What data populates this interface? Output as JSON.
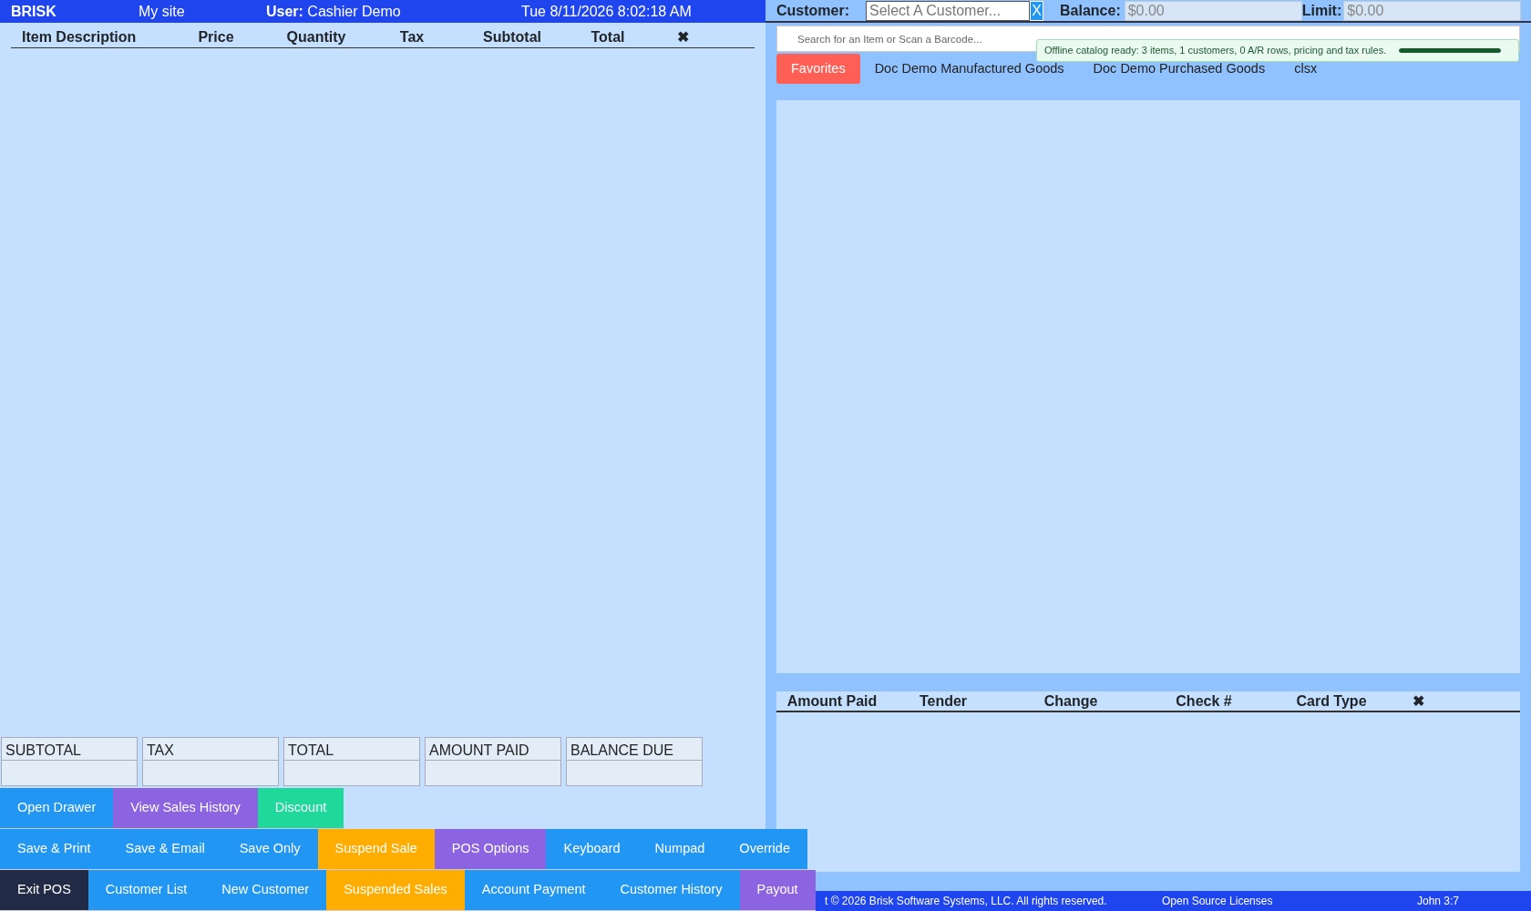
{
  "top_bar": {
    "brand": "BRISK",
    "site": "My site",
    "user_label": "User:",
    "user": "Cashier Demo",
    "datetime": "Tue 8/11/2026 8:02:18 AM"
  },
  "item_table": {
    "columns": [
      "Item Description",
      "Price",
      "Quantity",
      "Tax",
      "Subtotal",
      "Total",
      "✖"
    ]
  },
  "totals": [
    {
      "label": "SUBTOTAL"
    },
    {
      "label": "TAX"
    },
    {
      "label": "TOTAL"
    },
    {
      "label": "AMOUNT PAID"
    },
    {
      "label": "BALANCE DUE"
    }
  ],
  "button_rows": [
    [
      {
        "label": "Open Drawer",
        "color": "#2196f3"
      },
      {
        "label": "View Sales History",
        "color": "#8c63e0"
      },
      {
        "label": "Discount",
        "color": "#1ed99a"
      }
    ],
    [
      {
        "label": "Save & Print",
        "color": "#2196f3"
      },
      {
        "label": "Save & Email",
        "color": "#2196f3"
      },
      {
        "label": "Save Only",
        "color": "#2196f3"
      },
      {
        "label": "Suspend Sale",
        "color": "#ffad00"
      },
      {
        "label": "POS Options",
        "color": "#8c63e0"
      },
      {
        "label": "Keyboard",
        "color": "#2196f3"
      },
      {
        "label": "Numpad",
        "color": "#2196f3"
      },
      {
        "label": "Override",
        "color": "#2196f3"
      }
    ],
    [
      {
        "label": "Exit POS",
        "color": "#222b45"
      },
      {
        "label": "Customer List",
        "color": "#2196f3"
      },
      {
        "label": "New Customer",
        "color": "#2196f3"
      },
      {
        "label": "Suspended Sales",
        "color": "#ffad00"
      },
      {
        "label": "Account Payment",
        "color": "#2196f3"
      },
      {
        "label": "Customer History",
        "color": "#2196f3"
      },
      {
        "label": "Payout",
        "color": "#8c63e0"
      }
    ]
  ],
  "customer_bar": {
    "customer_label": "Customer:",
    "customer_placeholder": "Select A Customer...",
    "clear_button": "X",
    "balance_label": "Balance:",
    "balance": "$0.00",
    "limit_label": "Limit:",
    "limit": "$0.00"
  },
  "search": {
    "placeholder": "Search for an Item or Scan a Barcode..."
  },
  "notification": {
    "text": "Offline catalog ready: 3 items, 1 customers, 0 A/R rows, pricing and tax rules.",
    "level": 1
  },
  "category_tabs": [
    {
      "label": "Favorites",
      "selected": true
    },
    {
      "label": "Doc Demo Manufactured Goods",
      "selected": false
    },
    {
      "label": "Doc Demo Purchased Goods",
      "selected": false
    },
    {
      "label": "clsx",
      "selected": false
    }
  ],
  "payment_table": {
    "columns": [
      "Amount Paid",
      "Tender",
      "Change",
      "Check #",
      "Card Type",
      "✖"
    ]
  },
  "footer": {
    "copyright": "t © 2026 Brisk Software Systems, LLC. All rights reserved.",
    "licenses": "Open Source Licenses",
    "verse": "John 3:7"
  }
}
